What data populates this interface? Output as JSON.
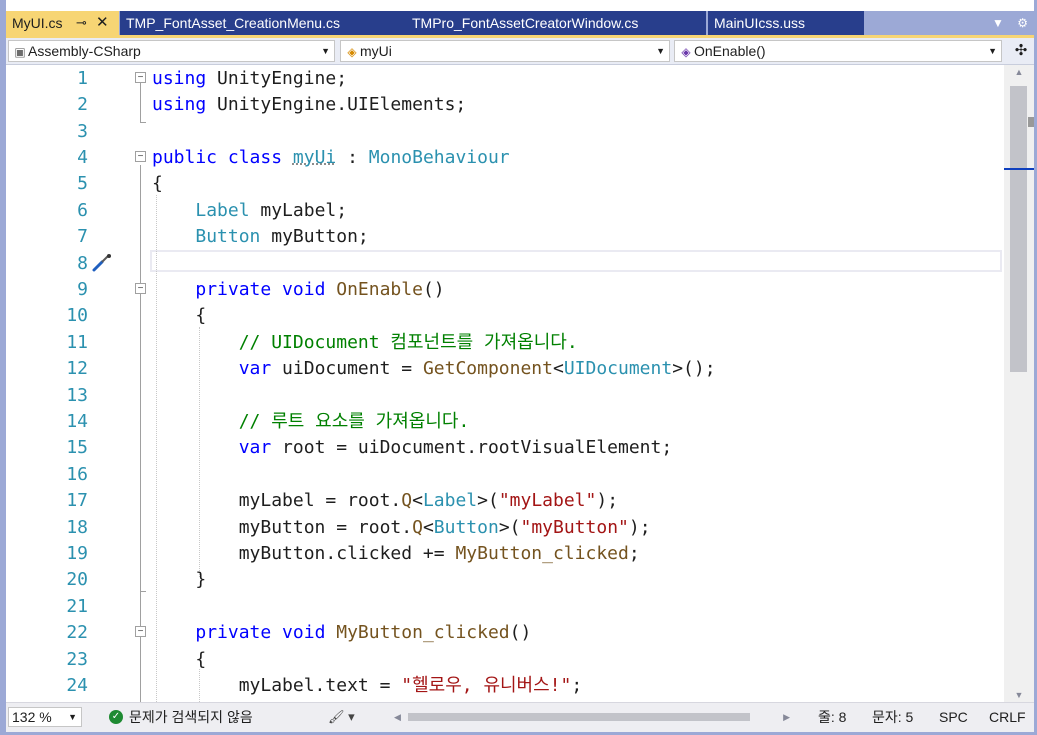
{
  "tabs": [
    {
      "label": "MyUI.cs",
      "active": true
    },
    {
      "label": "TMP_FontAsset_CreationMenu.cs",
      "active": false
    },
    {
      "label": "TMPro_FontAssetCreatorWindow.cs",
      "active": false
    },
    {
      "label": "MainUIcss.uss",
      "active": false
    }
  ],
  "icons": {
    "pin": "pin-icon",
    "close": "close-icon",
    "tab_list": "dropdown-icon",
    "settings": "gear-icon",
    "split": "split-icon",
    "project": "project-icon",
    "class": "class-icon",
    "method": "method-icon",
    "screwdriver": "screwdriver-icon",
    "check": "check-icon",
    "brush": "brush-icon"
  },
  "navbar": {
    "project": "Assembly-CSharp",
    "type": "myUi",
    "member": "OnEnable()"
  },
  "editor": {
    "line_numbers": [
      "1",
      "2",
      "3",
      "4",
      "5",
      "6",
      "7",
      "8",
      "9",
      "10",
      "11",
      "12",
      "13",
      "14",
      "15",
      "16",
      "17",
      "18",
      "19",
      "20",
      "21",
      "22",
      "23",
      "24"
    ],
    "lines": {
      "l1a": "using",
      "l1b": " UnityEngine;",
      "l2a": "using",
      "l2b": " UnityEngine.UIElements;",
      "l4a": "public class",
      "l4b": " ",
      "l4c": "myUi",
      "l4d": " : ",
      "l4e": "MonoBehaviour",
      "l5": "{",
      "l6a": "    ",
      "l6b": "Label",
      "l6c": " myLabel;",
      "l7a": "    ",
      "l7b": "Button",
      "l7c": " myButton;",
      "l9a": "    ",
      "l9b": "private void",
      "l9c": " ",
      "l9d": "OnEnable",
      "l9e": "()",
      "l10": "    {",
      "l11": "        // UIDocument 컴포넌트를 가져옵니다.",
      "l12a": "        ",
      "l12b": "var",
      "l12c": " uiDocument = ",
      "l12d": "GetComponent",
      "l12e": "<",
      "l12f": "UIDocument",
      "l12g": ">();",
      "l14": "        // 루트 요소를 가져옵니다.",
      "l15a": "        ",
      "l15b": "var",
      "l15c": " root = uiDocument.rootVisualElement;",
      "l17a": "        myLabel = root.",
      "l17b": "Q",
      "l17c": "<",
      "l17d": "Label",
      "l17e": ">(",
      "l17f": "\"myLabel\"",
      "l17g": ");",
      "l18a": "        myButton = root.",
      "l18b": "Q",
      "l18c": "<",
      "l18d": "Button",
      "l18e": ">(",
      "l18f": "\"myButton\"",
      "l18g": ");",
      "l19a": "        myButton.clicked += ",
      "l19b": "MyButton_clicked",
      "l19c": ";",
      "l20": "    }",
      "l22a": "    ",
      "l22b": "private void",
      "l22c": " ",
      "l22d": "MyButton_clicked",
      "l22e": "()",
      "l23": "    {",
      "l24a": "        myLabel.text = ",
      "l24b": "\"헬로우, 유니버스!\"",
      "l24c": ";"
    }
  },
  "statusbar": {
    "zoom": "132 %",
    "issues": "문제가 검색되지 않음",
    "line": "줄: 8",
    "char": "문자: 5",
    "spc": "SPC",
    "crlf": "CRLF"
  },
  "colors": {
    "tab_active": "#f7d574",
    "tab_inactive": "#283e8c",
    "frame": "#9ca9d6",
    "keyword": "#0000ff",
    "type": "#2b91af",
    "comment": "#008000",
    "string": "#a31515",
    "method": "#74531f"
  }
}
